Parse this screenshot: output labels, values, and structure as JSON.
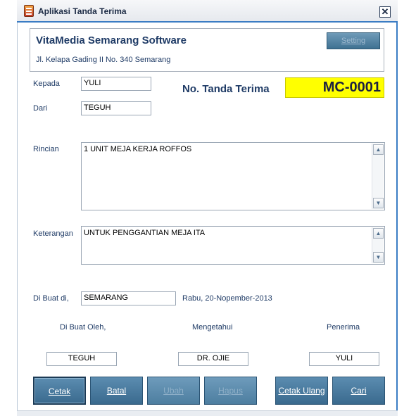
{
  "window": {
    "title": "Aplikasi Tanda Terima",
    "close_glyph": "✕"
  },
  "company": {
    "name": "VitaMedia Semarang Software",
    "address": "Jl. Kelapa Gading II No. 340 Semarang",
    "setting_label": "Setting"
  },
  "form": {
    "kepada_label": "Kepada",
    "kepada_value": "YULI",
    "dari_label": "Dari",
    "dari_value": "TEGUH",
    "no_label": "No. Tanda Terima",
    "no_value": "MC-0001",
    "rincian_label": "Rincian",
    "rincian_value": "1 UNIT MEJA KERJA ROFFOS",
    "keterangan_label": "Keterangan",
    "keterangan_value": "UNTUK PENGGANTIAN MEJA ITA",
    "dibuat_di_label": "Di Buat di,",
    "dibuat_di_value": "SEMARANG",
    "date": "Rabu, 20-Nopember-2013"
  },
  "signatures": {
    "dibuat_oleh_label": "Di Buat Oleh,",
    "dibuat_oleh_value": "TEGUH",
    "mengetahui_label": "Mengetahui",
    "mengetahui_value": "DR. OJIE",
    "penerima_label": "Penerima",
    "penerima_value": "YULI"
  },
  "buttons": {
    "cetak": "Cetak",
    "batal": "Batal",
    "ubah": "Ubah",
    "hapus": "Hapus",
    "cetak_ulang": "Cetak Ulang",
    "cari": "Cari"
  },
  "icons": {
    "app": "app-document-icon",
    "scroll_up": "▲",
    "scroll_down": "▼"
  },
  "colors": {
    "accent": "#3a7cc4",
    "button": "#4a7ba0",
    "number_highlight": "#ffff00"
  }
}
